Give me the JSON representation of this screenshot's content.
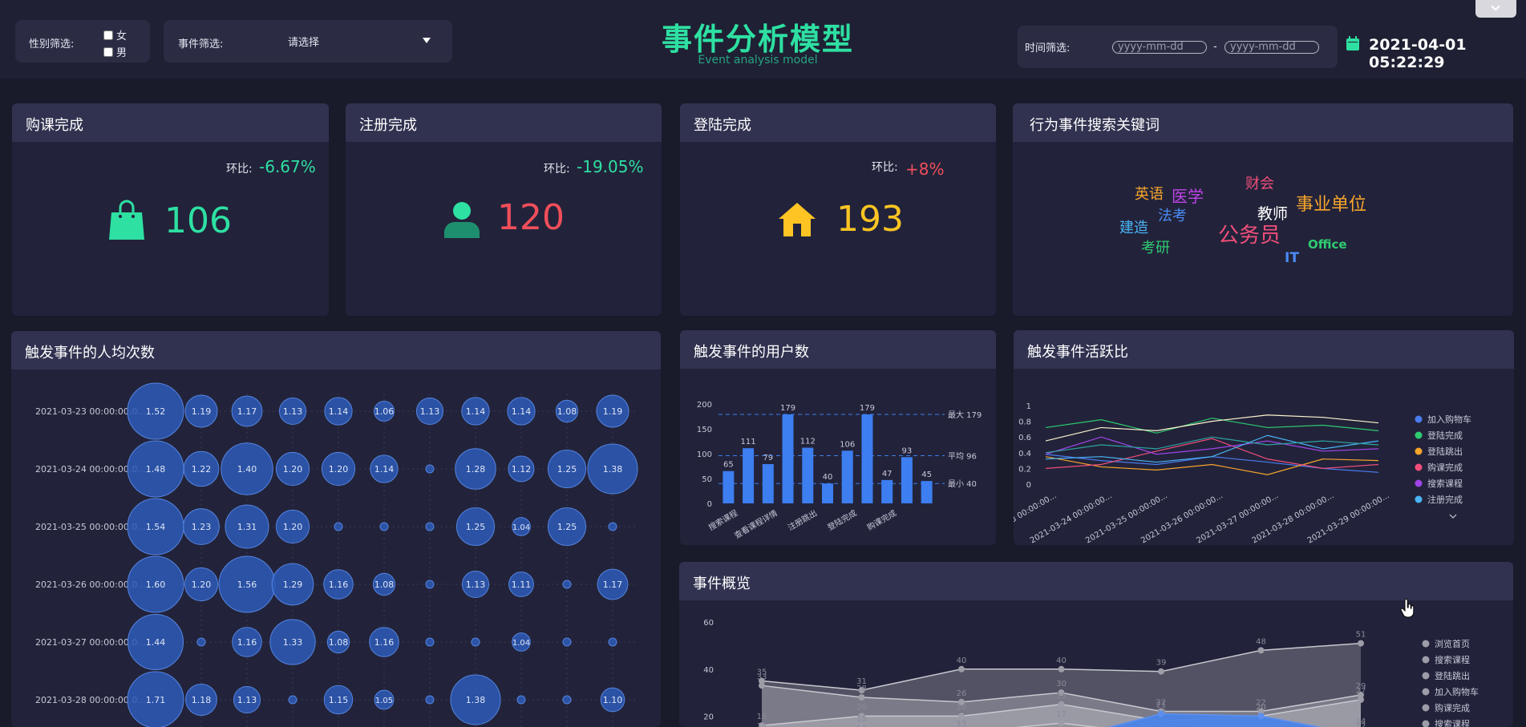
{
  "header": {
    "gender_filter_label": "性别筛选:",
    "gender_options": [
      "女",
      "男"
    ],
    "event_filter_label": "事件筛选:",
    "event_select_value": "请选择",
    "title": "事件分析模型",
    "subtitle": "Event analysis model",
    "time_filter_label": "时间筛选:",
    "date_placeholder": "yyyy-mm-dd",
    "date_separator": "-",
    "datetime": "2021-04-01 05:22:29"
  },
  "colors": {
    "green": "#2ee0a2",
    "red": "#f04e5a",
    "yellow": "#fdc423",
    "bar_blue": "#3d7ef0"
  },
  "kpis": [
    {
      "title": "购课完成",
      "ratio_label": "环比:",
      "ratio": "-6.67%",
      "value": "106",
      "icon": "shopping-bag-icon"
    },
    {
      "title": "注册完成",
      "ratio_label": "环比:",
      "ratio": "-19.05%",
      "value": "120",
      "icon": "user-icon"
    },
    {
      "title": "登陆完成",
      "ratio_label": "环比:",
      "ratio": "+8%",
      "value": "193",
      "icon": "house-icon"
    }
  ],
  "keywords": {
    "title": "行为事件搜索关键词",
    "words": [
      {
        "text": "英语",
        "color": "#f7a42c"
      },
      {
        "text": "医学",
        "color": "#c044e8"
      },
      {
        "text": "财会",
        "color": "#f04e7a"
      },
      {
        "text": "事业单位",
        "color": "#f7a42c"
      },
      {
        "text": "教师",
        "color": "#ffffff"
      },
      {
        "text": "法考",
        "color": "#4a8cf7"
      },
      {
        "text": "建造",
        "color": "#4ab4f7"
      },
      {
        "text": "公务员",
        "color": "#f04e7a"
      },
      {
        "text": "考研",
        "color": "#2ecc71"
      },
      {
        "text": "IT",
        "color": "#4a8cf7"
      },
      {
        "text": "Office",
        "color": "#2ecc71"
      }
    ]
  },
  "panels": {
    "bubble_title": "触发事件的人均次数",
    "users_title": "触发事件的用户数",
    "activity_title": "触发事件活跃比",
    "overview_title": "事件概览"
  },
  "chart_data": [
    {
      "type": "scatter",
      "title": "触发事件的人均次数",
      "rows": [
        "2021-03-23 00:00:00.0...",
        "2021-03-24 00:00:00.0...",
        "2021-03-25 00:00:00.0...",
        "2021-03-26 00:00:00.0...",
        "2021-03-27 00:00:00.0...",
        "2021-03-28 00:00:00.0..."
      ],
      "values": [
        [
          1.52,
          1.19,
          1.17,
          1.13,
          1.14,
          1.06,
          1.13,
          1.14,
          1.14,
          1.08,
          1.19
        ],
        [
          1.48,
          1.22,
          1.4,
          1.2,
          1.2,
          1.14,
          1,
          1.28,
          1.12,
          1.25,
          1.38
        ],
        [
          1.54,
          1.23,
          1.31,
          1.2,
          1,
          1,
          1,
          1.25,
          1.04,
          1.25,
          1
        ],
        [
          1.6,
          1.2,
          1.56,
          1.29,
          1.16,
          1.08,
          1,
          1.13,
          1.11,
          1,
          1.17
        ],
        [
          1.44,
          1,
          1.16,
          1.33,
          1.08,
          1.16,
          1,
          1,
          1.04,
          1,
          1
        ],
        [
          1.71,
          1.18,
          1.13,
          1,
          1.15,
          1.05,
          1,
          1.38,
          1,
          1,
          1.1
        ]
      ]
    },
    {
      "type": "bar",
      "title": "触发事件的用户数",
      "categories": [
        "搜索课程",
        "",
        "查看课程详情",
        "",
        "注册跳出",
        "",
        "登陆完成",
        "",
        "购课完成",
        ""
      ],
      "values": [
        65,
        111,
        79,
        179,
        112,
        40,
        106,
        179,
        47,
        93,
        45
      ],
      "ylim": [
        0,
        200
      ],
      "yticks": [
        0,
        50,
        100,
        150,
        200
      ],
      "marklines": [
        {
          "label": "最大 179",
          "value": 179
        },
        {
          "label": "平均 96",
          "value": 96
        },
        {
          "label": "最小 40",
          "value": 40
        }
      ]
    },
    {
      "type": "line",
      "title": "触发事件活跃比",
      "x": [
        ".-03-23 00:00:00...",
        "2021-03-24 00:00:00...",
        "2021-03-25 00:00:00...",
        "2021-03-26 00:00:00...",
        "2021-03-27 00:00:00...",
        "2021-03-28 00:00:00...",
        "2021-03-29 00:00:00..."
      ],
      "ylim": [
        0,
        1
      ],
      "yticks": [
        0,
        0.2,
        0.4,
        0.6,
        0.8,
        1
      ],
      "legend": [
        "加入购物车",
        "登陆完成",
        "登陆跳出",
        "购课完成",
        "搜索课程",
        "注册完成"
      ],
      "legend_colors": [
        "#4a7cf0",
        "#2ecc71",
        "#f7a42c",
        "#f04e7a",
        "#a044e8",
        "#4ab4f7"
      ],
      "series": [
        {
          "name": "加入购物车",
          "color": "#4a7cf0",
          "values": [
            0.38,
            0.3,
            0.25,
            0.35,
            0.28,
            0.2,
            0.15
          ]
        },
        {
          "name": "登陆完成",
          "color": "#2ecc71",
          "values": [
            0.72,
            0.82,
            0.65,
            0.84,
            0.72,
            0.75,
            0.68
          ]
        },
        {
          "name": "登陆跳出",
          "color": "#f7a42c",
          "values": [
            0.35,
            0.22,
            0.18,
            0.25,
            0.12,
            0.32,
            0.3
          ]
        },
        {
          "name": "购课完成",
          "color": "#f04e7a",
          "values": [
            0.2,
            0.25,
            0.42,
            0.58,
            0.32,
            0.2,
            0.25
          ]
        },
        {
          "name": "搜索课程",
          "color": "#a044e8",
          "values": [
            0.38,
            0.6,
            0.38,
            0.45,
            0.55,
            0.42,
            0.45
          ]
        },
        {
          "name": "注册完成",
          "color": "#4ab4f7",
          "values": [
            0.32,
            0.35,
            0.28,
            0.35,
            0.62,
            0.45,
            0.55
          ]
        },
        {
          "name": "",
          "color": "#fff3cf",
          "values": [
            0.55,
            0.72,
            0.68,
            0.8,
            0.88,
            0.85,
            0.78
          ]
        },
        {
          "name": "",
          "color": "#2ea3a0",
          "values": [
            0.4,
            0.5,
            0.45,
            0.6,
            0.5,
            0.55,
            0.5
          ]
        }
      ]
    },
    {
      "type": "area",
      "title": "事件概览",
      "ylim": [
        0,
        60
      ],
      "yticks": [
        20,
        40,
        60
      ],
      "legend": [
        "浏览首页",
        "搜索课程",
        "登陆跳出",
        "加入购物车",
        "购课完成",
        "搜索课程"
      ],
      "series": [
        {
          "name": "浏览首页",
          "values": [
            35,
            31,
            40,
            40,
            39,
            48,
            51
          ]
        },
        {
          "name": "搜索课程",
          "values": [
            33,
            28,
            26,
            30,
            22,
            22,
            29
          ]
        },
        {
          "name": "",
          "values": [
            16,
            20,
            20,
            25,
            18,
            20,
            27
          ]
        },
        {
          "name": "",
          "values": [
            12,
            15,
            13,
            17,
            12,
            14,
            14
          ]
        },
        {
          "name": "",
          "values": [
            10,
            11,
            9,
            10,
            21,
            20,
            12
          ]
        }
      ]
    }
  ]
}
